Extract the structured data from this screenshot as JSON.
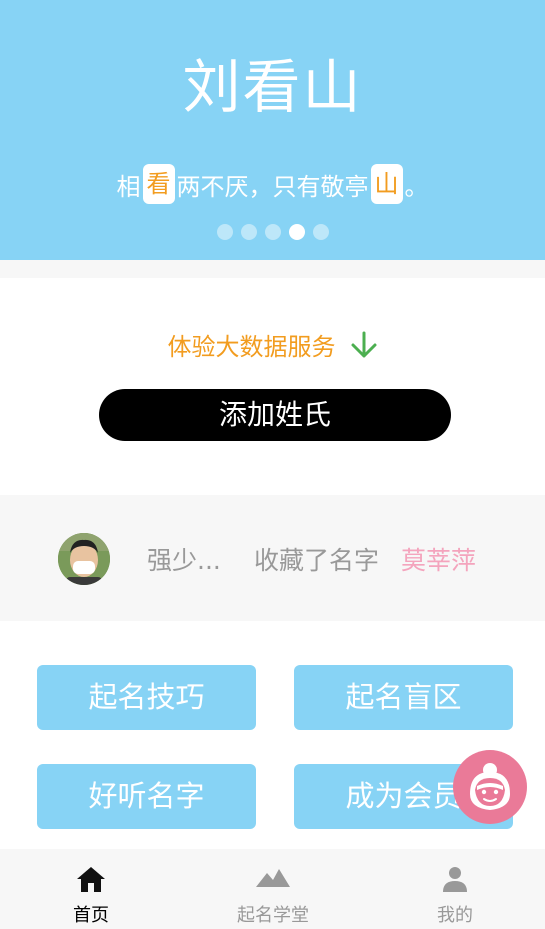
{
  "banner": {
    "title": "刘看山",
    "poem": {
      "part1": "相",
      "highlight1": "看",
      "part2": "两不厌，只有敬亭",
      "highlight2": "山",
      "part3": "。"
    },
    "pager": {
      "count": 5,
      "active_index": 3
    }
  },
  "service": {
    "text": "体验大数据服务",
    "icon": "arrow-down-icon"
  },
  "add_button": {
    "label": "添加姓氏"
  },
  "activity": {
    "user": "强少...",
    "action": "收藏了名字",
    "name": "莫莘萍"
  },
  "menu": {
    "items": [
      {
        "label": "起名技巧"
      },
      {
        "label": "起名盲区"
      },
      {
        "label": "好听名字"
      },
      {
        "label": "成为会员"
      }
    ]
  },
  "floating": {
    "icon": "customer-service-icon"
  },
  "tabbar": {
    "tabs": [
      {
        "label": "首页",
        "icon": "home-icon",
        "active": true
      },
      {
        "label": "起名学堂",
        "icon": "mountain-icon",
        "active": false
      },
      {
        "label": "我的",
        "icon": "user-icon",
        "active": false
      }
    ]
  },
  "colors": {
    "banner_bg": "#87d3f5",
    "accent_orange": "#f29c1f",
    "arrow_green": "#4caf50",
    "name_pink": "#f4a4bd",
    "float_pink": "#ea7a98"
  }
}
